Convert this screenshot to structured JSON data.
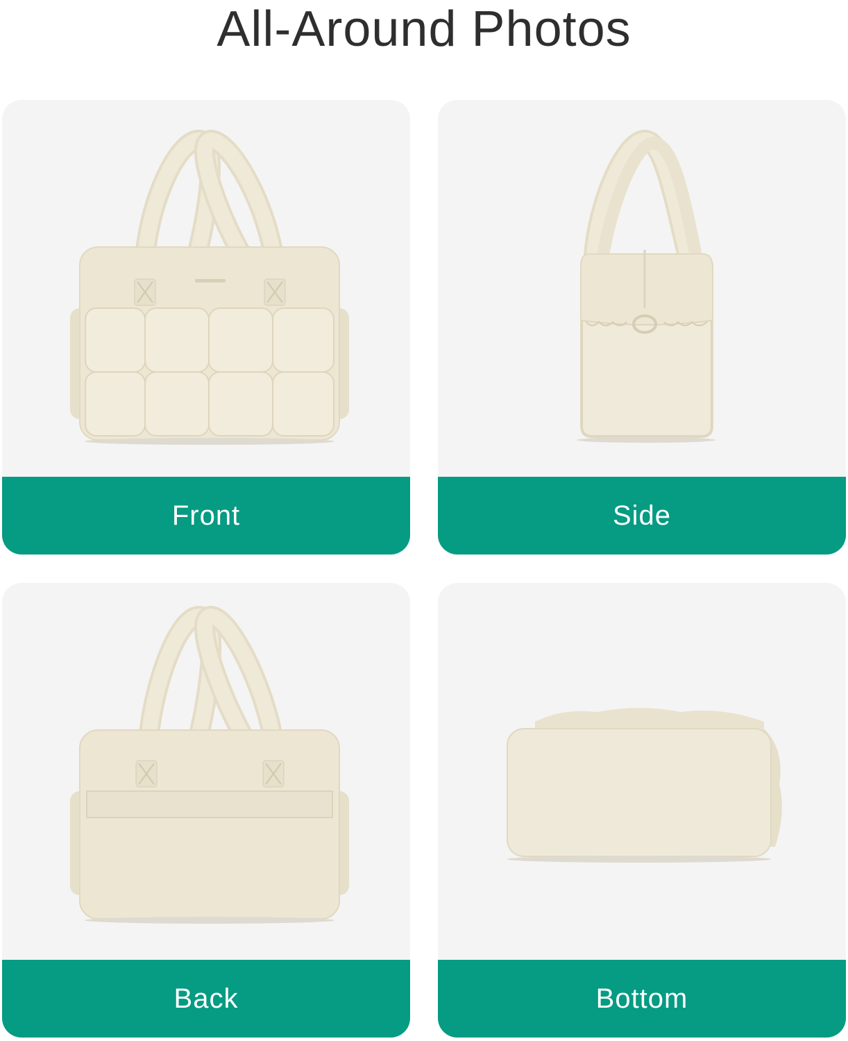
{
  "title": "All-Around Photos",
  "colors": {
    "accent": "#069b83",
    "card_bg": "#f4f4f4",
    "bag": "#ede6d3"
  },
  "views": [
    {
      "label": "Front",
      "image": "bag-front-view"
    },
    {
      "label": "Side",
      "image": "bag-side-view"
    },
    {
      "label": "Back",
      "image": "bag-back-view"
    },
    {
      "label": "Bottom",
      "image": "bag-bottom-view"
    }
  ]
}
